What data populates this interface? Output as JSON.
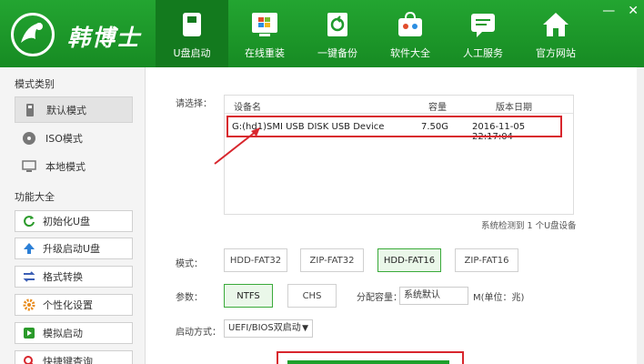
{
  "app": {
    "logo_text": "韩博士",
    "colors": {
      "brand_green": "#1f9a2c",
      "active_tab": "#137a1e",
      "highlight_red": "#d8262d"
    }
  },
  "nav": [
    {
      "label": "U盘启动",
      "icon": "usb-drive-icon",
      "active": true
    },
    {
      "label": "在线重装",
      "icon": "windows-icon"
    },
    {
      "label": "一键备份",
      "icon": "backup-icon"
    },
    {
      "label": "软件大全",
      "icon": "apps-bag-icon"
    },
    {
      "label": "人工服务",
      "icon": "chat-icon"
    },
    {
      "label": "官方网站",
      "icon": "home-icon"
    }
  ],
  "window_controls": {
    "minimize": "—",
    "close": "✕"
  },
  "sidebar": {
    "mode_title": "模式类别",
    "modes": [
      {
        "label": "默认模式",
        "icon": "usb-icon",
        "selected": true
      },
      {
        "label": "ISO模式",
        "icon": "disc-icon"
      },
      {
        "label": "本地模式",
        "icon": "monitor-icon"
      }
    ],
    "func_title": "功能大全",
    "funcs": [
      {
        "label": "初始化U盘",
        "icon": "refresh-icon"
      },
      {
        "label": "升级启动U盘",
        "icon": "arrow-up-icon"
      },
      {
        "label": "格式转换",
        "icon": "swap-icon"
      },
      {
        "label": "个性化设置",
        "icon": "gear-icon"
      },
      {
        "label": "模拟启动",
        "icon": "play-icon"
      },
      {
        "label": "快捷键查询",
        "icon": "search-icon"
      }
    ]
  },
  "main": {
    "select_label": "请选择：",
    "table": {
      "headers": [
        "设备名",
        "容量",
        "版本日期"
      ],
      "row": {
        "name": "G:(hd1)SMI USB DISK USB Device",
        "size": "7.50G",
        "date": "2016-11-05 22:17:04"
      }
    },
    "detected": "系统检测到 1 个U盘设备",
    "mode_label": "模式：",
    "modes": [
      "HDD-FAT32",
      "ZIP-FAT32",
      "HDD-FAT16",
      "ZIP-FAT16"
    ],
    "mode_selected": "HDD-FAT16",
    "param_label": "参数：",
    "params": [
      "NTFS",
      "CHS"
    ],
    "param_selected": "NTFS",
    "alloc_label": "分配容量：",
    "alloc_value": "系统默认",
    "alloc_unit": "M(单位：兆)",
    "boot_label": "启动方式：",
    "boot_value": "UEFI/BIOS双启动"
  }
}
